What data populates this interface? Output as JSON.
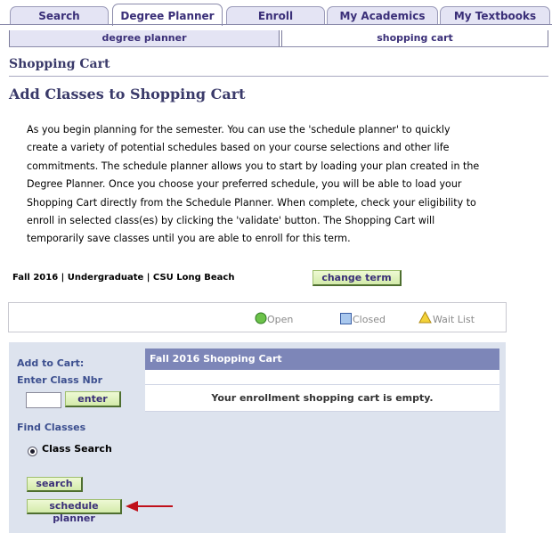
{
  "tabs": [
    "Search",
    "Degree Planner",
    "Enroll",
    "My Academics",
    "My Textbooks"
  ],
  "subtabs": [
    "degree planner",
    "shopping cart"
  ],
  "page_title": "Shopping Cart",
  "section_title": "Add Classes to Shopping Cart",
  "intro_lines": [
    "As you begin planning for the semester.  You can use the 'schedule planner' to quickly",
    "create a variety of potential schedules based on your course selections and other life",
    "commitments. The schedule planner allows you to start by loading your plan created in the",
    "Degree Planner. Once you choose your preferred schedule, you will be able to load your",
    "Shopping Cart directly from the Schedule Planner. When complete, check your eligibility to",
    "enroll in selected class(es) by clicking the 'validate' button. The Shopping Cart will",
    "temporarily save classes until you are able to enroll for this term."
  ],
  "term": "Fall 2016 | Undergraduate | CSU Long Beach",
  "change_term_label": "change term",
  "legend": {
    "open": "Open",
    "closed": "Closed",
    "wait_list": "Wait List"
  },
  "add_to_cart": {
    "heading": "Add to Cart:",
    "enter_class_nbr": "Enter Class Nbr",
    "class_nbr_value": "",
    "enter_label": "enter",
    "find_classes": "Find Classes",
    "class_search": "Class Search",
    "search_label": "search",
    "schedule_planner_label": "schedule planner"
  },
  "cart": {
    "title": "Fall 2016 Shopping Cart",
    "empty_message": "Your enrollment shopping cart is empty."
  },
  "colors": {
    "accent": "#3a2f78",
    "cart_header": "#7d86b8",
    "panel": "#dde3ee",
    "button": "#d3ebaa",
    "arrow": "#c0101a"
  }
}
